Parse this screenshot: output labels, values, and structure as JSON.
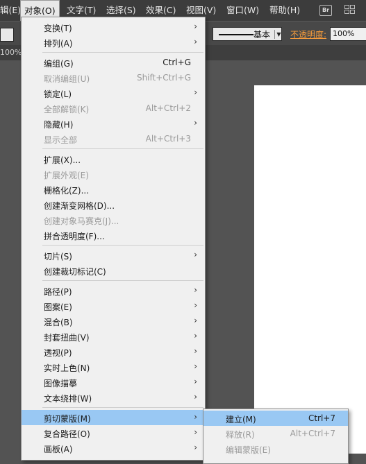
{
  "menubar": {
    "items": [
      {
        "label": "辑(E)"
      },
      {
        "label": "对象(O)"
      },
      {
        "label": "文字(T)"
      },
      {
        "label": "选择(S)"
      },
      {
        "label": "效果(C)"
      },
      {
        "label": "视图(V)"
      },
      {
        "label": "窗口(W)"
      },
      {
        "label": "帮助(H)"
      }
    ],
    "bridge_icon_text": "Br"
  },
  "controlbar": {
    "stroke_label": "基本",
    "opacity_label": "不透明度:",
    "opacity_value": "100%"
  },
  "tabbar": {
    "zoom": "100%"
  },
  "object_menu": {
    "items": [
      {
        "label": "变换(T)",
        "shortcut": "",
        "submenu": true,
        "disabled": false
      },
      {
        "label": "排列(A)",
        "shortcut": "",
        "submenu": true,
        "disabled": false
      },
      {
        "label": "编组(G)",
        "shortcut": "Ctrl+G",
        "submenu": false,
        "disabled": false
      },
      {
        "label": "取消编组(U)",
        "shortcut": "Shift+Ctrl+G",
        "submenu": false,
        "disabled": true
      },
      {
        "label": "锁定(L)",
        "shortcut": "",
        "submenu": true,
        "disabled": false
      },
      {
        "label": "全部解锁(K)",
        "shortcut": "Alt+Ctrl+2",
        "submenu": false,
        "disabled": true
      },
      {
        "label": "隐藏(H)",
        "shortcut": "",
        "submenu": true,
        "disabled": false
      },
      {
        "label": "显示全部",
        "shortcut": "Alt+Ctrl+3",
        "submenu": false,
        "disabled": true
      },
      {
        "label": "扩展(X)...",
        "shortcut": "",
        "submenu": false,
        "disabled": false
      },
      {
        "label": "扩展外观(E)",
        "shortcut": "",
        "submenu": false,
        "disabled": true
      },
      {
        "label": "栅格化(Z)...",
        "shortcut": "",
        "submenu": false,
        "disabled": false
      },
      {
        "label": "创建渐变网格(D)...",
        "shortcut": "",
        "submenu": false,
        "disabled": false
      },
      {
        "label": "创建对象马赛克(J)...",
        "shortcut": "",
        "submenu": false,
        "disabled": true
      },
      {
        "label": "拼合透明度(F)...",
        "shortcut": "",
        "submenu": false,
        "disabled": false
      },
      {
        "label": "切片(S)",
        "shortcut": "",
        "submenu": true,
        "disabled": false
      },
      {
        "label": "创建裁切标记(C)",
        "shortcut": "",
        "submenu": false,
        "disabled": false
      },
      {
        "label": "路径(P)",
        "shortcut": "",
        "submenu": true,
        "disabled": false
      },
      {
        "label": "图案(E)",
        "shortcut": "",
        "submenu": true,
        "disabled": false
      },
      {
        "label": "混合(B)",
        "shortcut": "",
        "submenu": true,
        "disabled": false
      },
      {
        "label": "封套扭曲(V)",
        "shortcut": "",
        "submenu": true,
        "disabled": false
      },
      {
        "label": "透视(P)",
        "shortcut": "",
        "submenu": true,
        "disabled": false
      },
      {
        "label": "实时上色(N)",
        "shortcut": "",
        "submenu": true,
        "disabled": false
      },
      {
        "label": "图像描摹",
        "shortcut": "",
        "submenu": true,
        "disabled": false
      },
      {
        "label": "文本绕排(W)",
        "shortcut": "",
        "submenu": true,
        "disabled": false
      },
      {
        "label": "剪切蒙版(M)",
        "shortcut": "",
        "submenu": true,
        "disabled": false,
        "highlighted": true
      },
      {
        "label": "复合路径(O)",
        "shortcut": "",
        "submenu": true,
        "disabled": false
      },
      {
        "label": "画板(A)",
        "shortcut": "",
        "submenu": true,
        "disabled": false
      }
    ]
  },
  "clipping_mask_submenu": {
    "items": [
      {
        "label": "建立(M)",
        "shortcut": "Ctrl+7",
        "disabled": false,
        "highlighted": true
      },
      {
        "label": "释放(R)",
        "shortcut": "Alt+Ctrl+7",
        "disabled": true
      },
      {
        "label": "编辑蒙版(E)",
        "shortcut": "",
        "disabled": true
      }
    ]
  },
  "colors": {
    "highlight": "#99c8f3",
    "menu_bg": "#f0f0f0",
    "app_bg": "#535353",
    "opacity_link": "#f59b3b"
  }
}
